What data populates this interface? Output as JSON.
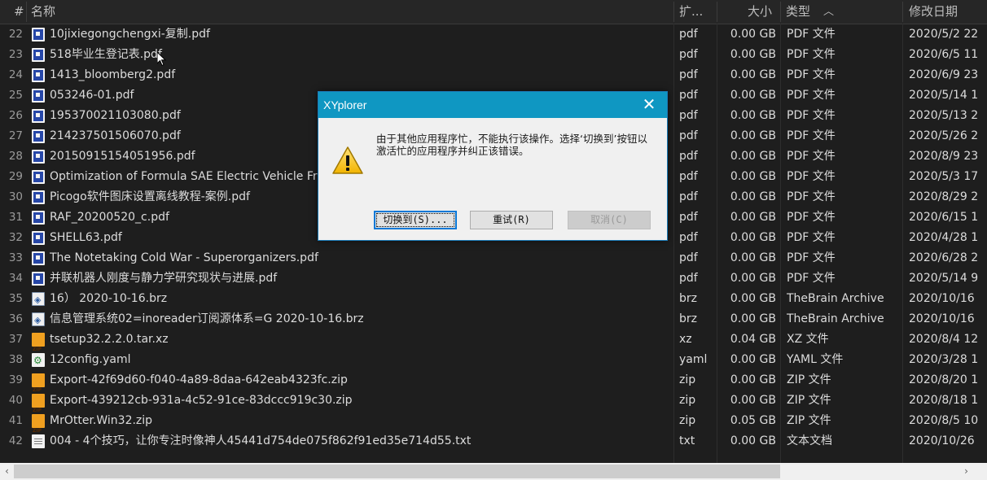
{
  "header": {
    "num": "#",
    "name": "名称",
    "ext": "扩...",
    "size": "大小",
    "type": "类型",
    "date": "修改日期",
    "sort_indicator": "up-arrow"
  },
  "rows": [
    {
      "num": "22",
      "name": "10jixiegongchengxi-复制.pdf",
      "ext": "pdf",
      "size": "0.00 GB",
      "type": "PDF 文件",
      "date": "2020/5/2 22",
      "icon": "pdf"
    },
    {
      "num": "23",
      "name": "518毕业生登记表.pdf",
      "ext": "pdf",
      "size": "0.00 GB",
      "type": "PDF 文件",
      "date": "2020/6/5 11",
      "icon": "pdf"
    },
    {
      "num": "24",
      "name": "1413_bloomberg2.pdf",
      "ext": "pdf",
      "size": "0.00 GB",
      "type": "PDF 文件",
      "date": "2020/6/9 23",
      "icon": "pdf"
    },
    {
      "num": "25",
      "name": "053246-01.pdf",
      "ext": "pdf",
      "size": "0.00 GB",
      "type": "PDF 文件",
      "date": "2020/5/14 1",
      "icon": "pdf"
    },
    {
      "num": "26",
      "name": "195370021103080.pdf",
      "ext": "pdf",
      "size": "0.00 GB",
      "type": "PDF 文件",
      "date": "2020/5/13 2",
      "icon": "pdf"
    },
    {
      "num": "27",
      "name": "214237501506070.pdf",
      "ext": "pdf",
      "size": "0.00 GB",
      "type": "PDF 文件",
      "date": "2020/5/26 2",
      "icon": "pdf"
    },
    {
      "num": "28",
      "name": "20150915154051956.pdf",
      "ext": "pdf",
      "size": "0.00 GB",
      "type": "PDF 文件",
      "date": "2020/8/9 23",
      "icon": "pdf"
    },
    {
      "num": "29",
      "name": "Optimization of Formula SAE Electric Vehicle Fram",
      "ext": "pdf",
      "size": "0.00 GB",
      "type": "PDF 文件",
      "date": "2020/5/3 17",
      "icon": "pdf"
    },
    {
      "num": "30",
      "name": "Picogo软件图床设置离线教程-案例.pdf",
      "ext": "pdf",
      "size": "0.00 GB",
      "type": "PDF 文件",
      "date": "2020/8/29 2",
      "icon": "pdf"
    },
    {
      "num": "31",
      "name": "RAF_20200520_c.pdf",
      "ext": "pdf",
      "size": "0.00 GB",
      "type": "PDF 文件",
      "date": "2020/6/15 1",
      "icon": "pdf"
    },
    {
      "num": "32",
      "name": "SHELL63.pdf",
      "ext": "pdf",
      "size": "0.00 GB",
      "type": "PDF 文件",
      "date": "2020/4/28 1",
      "icon": "pdf"
    },
    {
      "num": "33",
      "name": "The Notetaking Cold War - Superorganizers.pdf",
      "ext": "pdf",
      "size": "0.00 GB",
      "type": "PDF 文件",
      "date": "2020/6/28 2",
      "icon": "pdf"
    },
    {
      "num": "34",
      "name": "并联机器人刚度与静力学研究现状与进展.pdf",
      "ext": "pdf",
      "size": "0.00 GB",
      "type": "PDF 文件",
      "date": "2020/5/14 9",
      "icon": "pdf"
    },
    {
      "num": "35",
      "name": "16） 2020-10-16.brz",
      "ext": "brz",
      "size": "0.00 GB",
      "type": "TheBrain Archive",
      "date": "2020/10/16",
      "icon": "brz"
    },
    {
      "num": "36",
      "name": "信息管理系统02=inoreader订阅源体系=G 2020-10-16.brz",
      "ext": "brz",
      "size": "0.00 GB",
      "type": "TheBrain Archive",
      "date": "2020/10/16",
      "icon": "brz"
    },
    {
      "num": "37",
      "name": "tsetup32.2.2.0.tar.xz",
      "ext": "xz",
      "size": "0.04 GB",
      "type": "XZ 文件",
      "date": "2020/8/4 12",
      "icon": "zip"
    },
    {
      "num": "38",
      "name": "12config.yaml",
      "ext": "yaml",
      "size": "0.00 GB",
      "type": "YAML 文件",
      "date": "2020/3/28 1",
      "icon": "yaml"
    },
    {
      "num": "39",
      "name": "Export-42f69d60-f040-4a89-8daa-642eab4323fc.zip",
      "ext": "zip",
      "size": "0.00 GB",
      "type": "ZIP 文件",
      "date": "2020/8/20 1",
      "icon": "zip"
    },
    {
      "num": "40",
      "name": "Export-439212cb-931a-4c52-91ce-83dccc919c30.zip",
      "ext": "zip",
      "size": "0.00 GB",
      "type": "ZIP 文件",
      "date": "2020/8/18 1",
      "icon": "zip"
    },
    {
      "num": "41",
      "name": "MrOtter.Win32.zip",
      "ext": "zip",
      "size": "0.05 GB",
      "type": "ZIP 文件",
      "date": "2020/8/5 10",
      "icon": "zip"
    },
    {
      "num": "42",
      "name": "004 - 4个技巧，让你专注时像神人45441d754de075f862f91ed35e714d55.txt",
      "ext": "txt",
      "size": "0.00 GB",
      "type": "文本文档",
      "date": "2020/10/26",
      "icon": "txt"
    }
  ],
  "dialog": {
    "title": "XYplorer",
    "close_glyph": "✕",
    "message": "由于其他应用程序忙，不能执行该操作。选择‘切换到’按钮以激活忙的应用程序并纠正该错误。",
    "icon": "warning-icon",
    "buttons": {
      "switch_to": "切换到(S)...",
      "retry": "重试(R)",
      "cancel": "取消(C)"
    }
  },
  "scrollbar": {
    "left_arrow": "‹",
    "right_arrow": "›"
  }
}
